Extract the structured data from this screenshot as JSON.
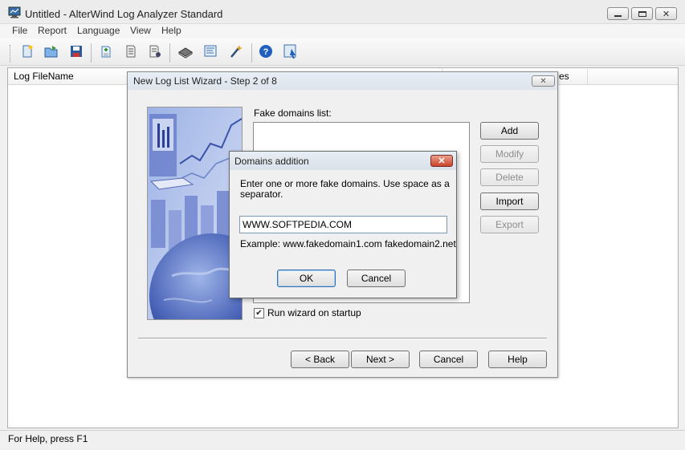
{
  "window": {
    "title": "Untitled - AlterWind Log Analyzer Standard"
  },
  "menu": [
    "File",
    "Report",
    "Language",
    "View",
    "Help"
  ],
  "toolbar": {
    "icons": [
      "new-report-icon",
      "open-icon",
      "save-icon",
      "add-log-icon",
      "log-list-icon",
      "log-properties-icon",
      "analyze-icon",
      "report-settings-icon",
      "wizard-icon",
      "help-icon",
      "context-help-icon"
    ]
  },
  "list": {
    "columns": [
      "Log FileName",
      "es"
    ]
  },
  "status": {
    "text": "For Help, press F1"
  },
  "wizard": {
    "title": "New Log List Wizard - Step 2 of 8",
    "list_label": "Fake domains list:",
    "buttons": {
      "add": "Add",
      "modify": "Modify",
      "delete": "Delete",
      "import": "Import",
      "export": "Export"
    },
    "run_on_startup": "Run wizard on startup",
    "run_on_startup_checked": true,
    "nav": {
      "back": "< Back",
      "next": "Next >",
      "cancel": "Cancel",
      "help": "Help"
    }
  },
  "domains_dialog": {
    "title": "Domains addition",
    "prompt": "Enter one or more fake domains. Use space as a separator.",
    "input_value": "WWW.SOFTPEDIA.COM",
    "example": "Example: www.fakedomain1.com  fakedomain2.net",
    "ok": "OK",
    "cancel": "Cancel"
  },
  "colors": {
    "dialog_bg": "#f0f0f0",
    "close_button": "#c9432a",
    "default_button_border": "#2f6fad"
  }
}
